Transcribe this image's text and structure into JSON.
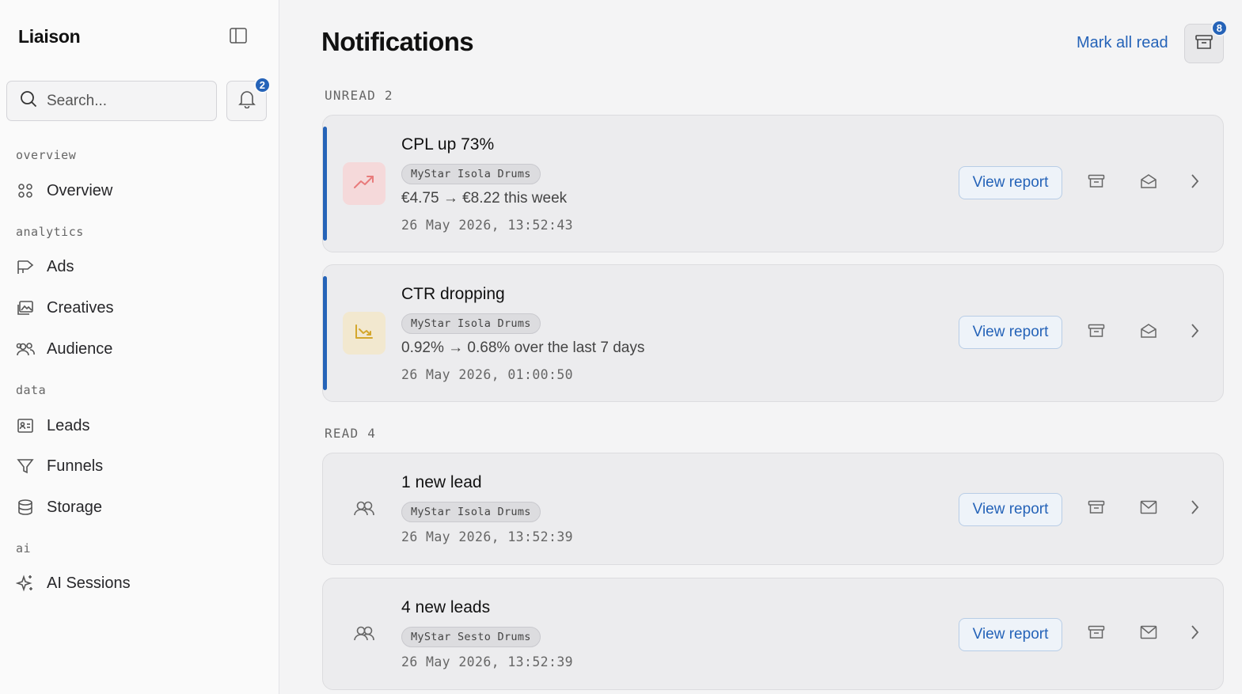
{
  "app": {
    "name": "Liaison"
  },
  "search": {
    "placeholder": "Search..."
  },
  "bell": {
    "count": "2"
  },
  "nav": {
    "groups": [
      {
        "label": "overview",
        "items": [
          {
            "label": "Overview",
            "icon": "grid-icon"
          }
        ]
      },
      {
        "label": "analytics",
        "items": [
          {
            "label": "Ads",
            "icon": "megaphone-icon"
          },
          {
            "label": "Creatives",
            "icon": "images-icon"
          },
          {
            "label": "Audience",
            "icon": "users-icon"
          }
        ]
      },
      {
        "label": "data",
        "items": [
          {
            "label": "Leads",
            "icon": "contact-card-icon"
          },
          {
            "label": "Funnels",
            "icon": "funnel-icon"
          },
          {
            "label": "Storage",
            "icon": "database-icon"
          }
        ]
      },
      {
        "label": "ai",
        "items": [
          {
            "label": "AI Sessions",
            "icon": "sparkles-icon"
          }
        ]
      }
    ]
  },
  "header": {
    "title": "Notifications",
    "mark_all_read": "Mark all read",
    "archive_count": "8"
  },
  "sections": {
    "unread": {
      "label": "UNREAD",
      "count": "2"
    },
    "read": {
      "label": "READ",
      "count": "4"
    }
  },
  "notifications": [
    {
      "title": "CPL up 73%",
      "tag": "MyStar Isola Drums",
      "desc": "€4.75 → €8.22 this week",
      "time": "26 May 2026, 13:52:43",
      "action": "View report",
      "icon": "trending-up-icon",
      "icon_color": "#e87b7b",
      "icon_bg": "#f5d9da"
    },
    {
      "title": "CTR dropping",
      "tag": "MyStar Isola Drums",
      "desc": "0.92% → 0.68% over the last 7 days",
      "time": "26 May 2026, 01:00:50",
      "action": "View report",
      "icon": "chart-down-icon",
      "icon_color": "#d4a72c",
      "icon_bg": "#f2e8cf"
    },
    {
      "title": "1 new lead",
      "tag": "MyStar Isola Drums",
      "desc": "",
      "time": "26 May 2026, 13:52:39",
      "action": "View report",
      "icon": "users-icon",
      "icon_color": "#666666",
      "icon_bg": ""
    },
    {
      "title": "4 new leads",
      "tag": "MyStar Sesto Drums",
      "desc": "",
      "time": "26 May 2026, 13:52:39",
      "action": "View report",
      "icon": "users-icon",
      "icon_color": "#666666",
      "icon_bg": ""
    }
  ],
  "colors": {
    "accent": "#2563b8",
    "background": "#f4f4f5",
    "card": "#ececee"
  }
}
